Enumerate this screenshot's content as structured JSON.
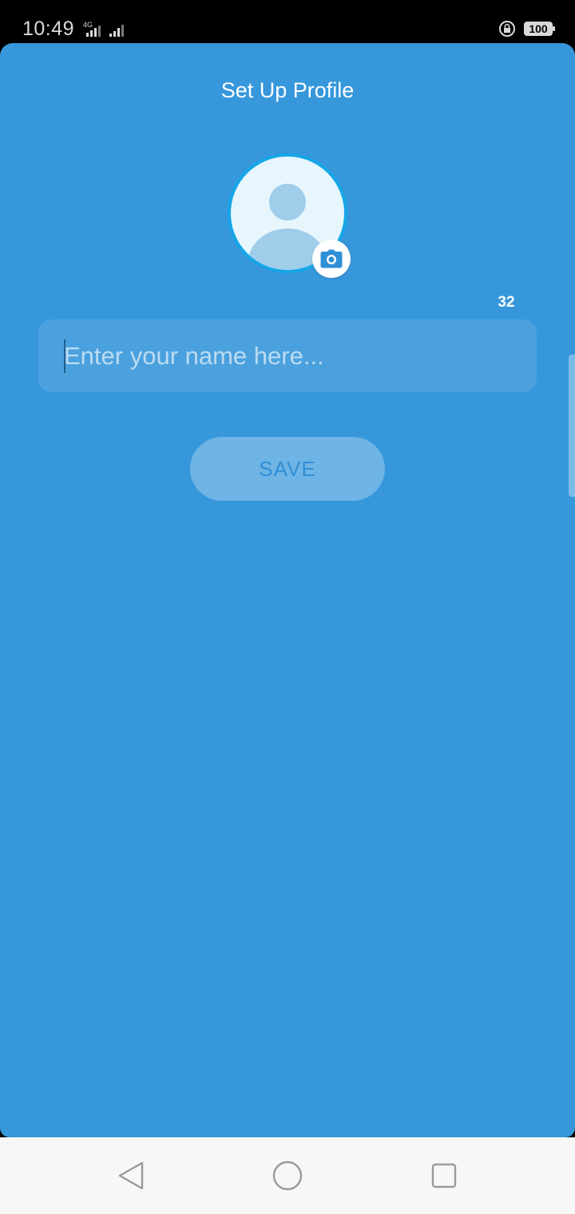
{
  "status_bar": {
    "time": "10:49",
    "network_label": "4G",
    "battery": "100"
  },
  "header": {
    "title": "Set Up Profile"
  },
  "profile": {
    "avatar_icon": "user-silhouette-icon",
    "camera_icon": "camera-icon"
  },
  "name_input": {
    "placeholder": "Enter your name here...",
    "value": "",
    "remaining_chars": "32"
  },
  "actions": {
    "save_label": "SAVE"
  },
  "colors": {
    "background": "#3797db",
    "avatar_border": "#15a6e8",
    "avatar_fill": "#e7f6fc",
    "save_text": "#2f8fd6"
  },
  "nav": {
    "back_icon": "triangle-back-icon",
    "home_icon": "circle-home-icon",
    "recents_icon": "square-recents-icon"
  }
}
